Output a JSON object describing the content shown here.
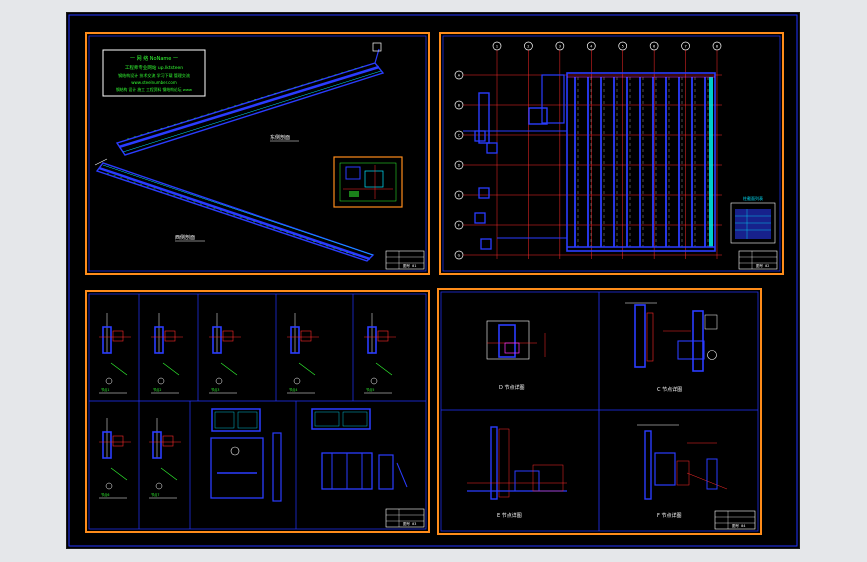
{
  "viewer": {
    "background_color": "#e5e7ea",
    "canvas_color": "#000000"
  },
  "colors": {
    "sheet_border": "#ff8c1a",
    "outer_border": "#2233ff",
    "steel": "#2a3cff",
    "grid_line": "#ff2a2a",
    "dimension": "#00e5ff",
    "text_green": "#33ff33",
    "text_white": "#ffffff",
    "accent_cyan": "#00ffff",
    "highlight_magenta": "#ff33ff"
  },
  "sheets": {
    "top_left": {
      "info_box": {
        "line1": "一 网 络 NoName 一",
        "line2": "工程师专业网站 up.lktsteen",
        "line3": "钢结构设计 技术交流 学习下载 管理交流",
        "line4": "www.steelnumber.com",
        "line5": "钢结构 设计 施工 工程资料 钢结构论坛 www"
      },
      "upper_view_label": "东侧剖面",
      "lower_view_label": "西侧剖面",
      "title_block": "图号 01"
    },
    "top_right": {
      "axis_labels": [
        "1",
        "2",
        "3",
        "4",
        "5",
        "6",
        "7",
        "8"
      ],
      "row_labels": [
        "A",
        "B",
        "C",
        "D",
        "E",
        "F",
        "G"
      ],
      "legend_title": "柱截面列表",
      "title_block": "图号 02"
    },
    "bottom_left": {
      "detail_labels": [
        "节点1",
        "节点2",
        "节点3",
        "节点4",
        "节点5",
        "节点6",
        "节点7",
        "节点8",
        "节点9",
        "节点10"
      ],
      "title_block": "图号 03"
    },
    "bottom_right": {
      "view_labels": [
        "D 节点详图",
        "C 节点详图",
        "E 节点详图",
        "F 节点详图"
      ],
      "title_block": "图号 04"
    }
  }
}
